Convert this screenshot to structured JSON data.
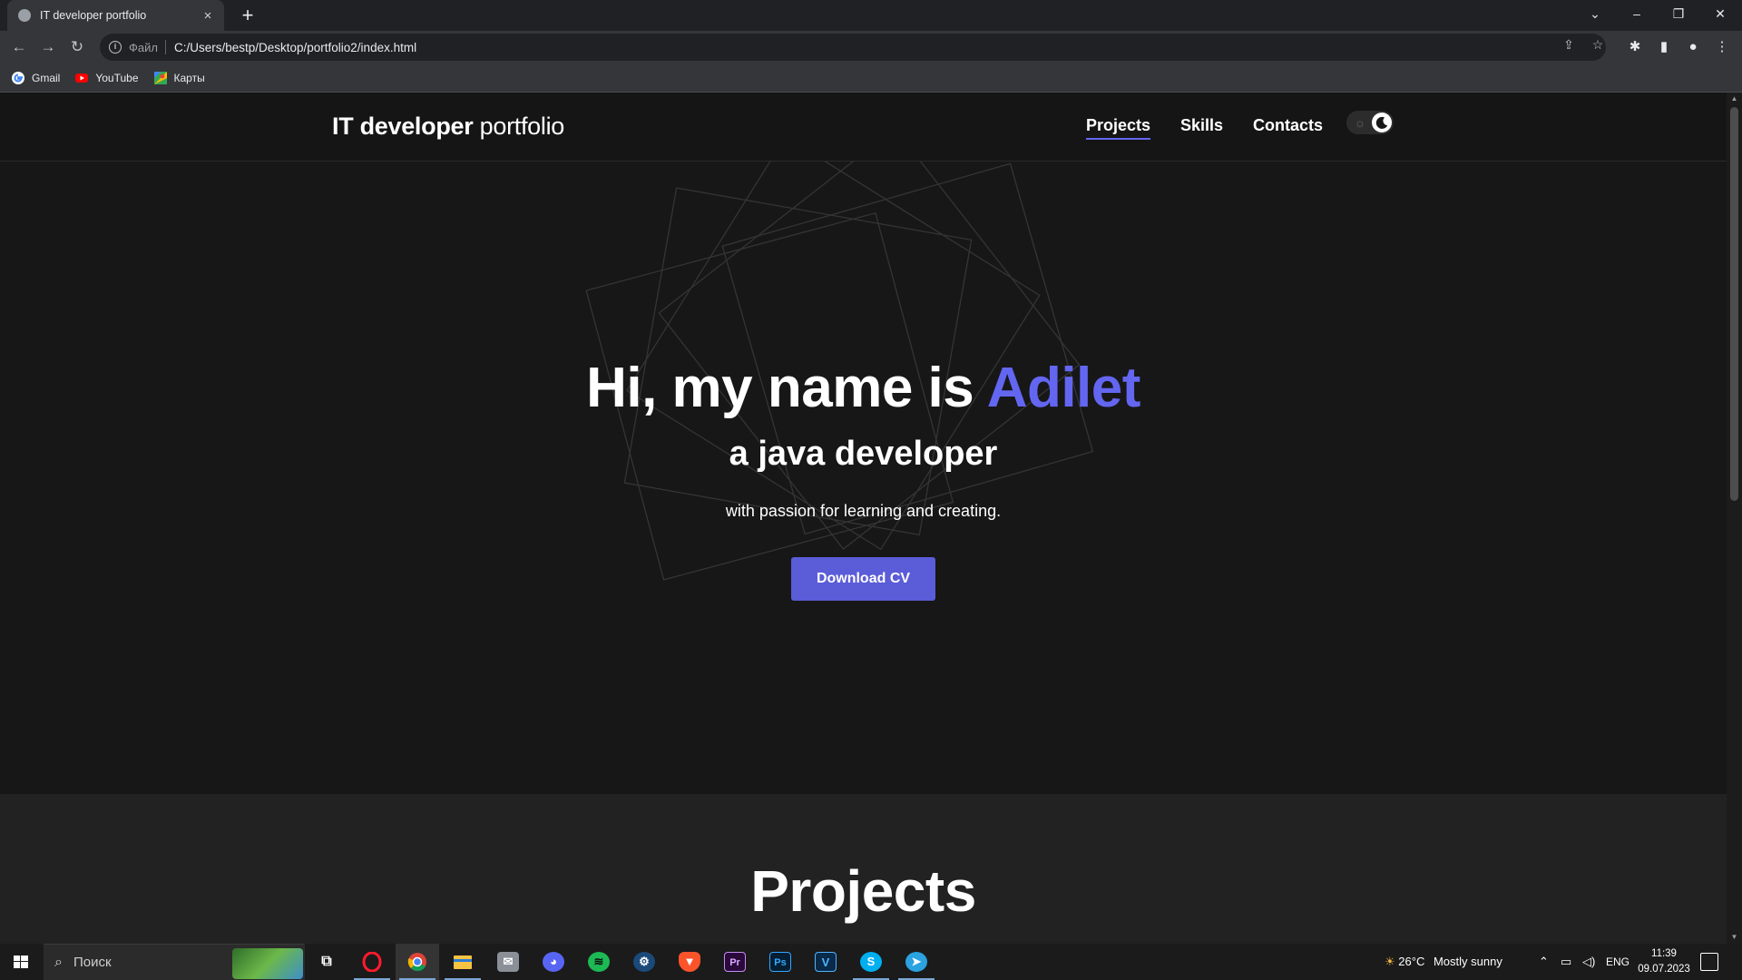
{
  "browser": {
    "tab_title": "IT developer portfolio",
    "tab_close": "×",
    "new_tab": "+",
    "scheme_label": "Файл",
    "url": "C:/Users/bestp/Desktop/portfolio2/index.html",
    "bookmarks": [
      {
        "label": "Gmail",
        "icon": "gmail-icon"
      },
      {
        "label": "YouTube",
        "icon": "youtube-icon"
      },
      {
        "label": "Карты",
        "icon": "maps-icon"
      }
    ]
  },
  "site": {
    "logo_bold": "IT developer",
    "logo_light": "portfolio",
    "nav": [
      {
        "label": "Projects",
        "active": true
      },
      {
        "label": "Skills",
        "active": false
      },
      {
        "label": "Contacts",
        "active": false
      }
    ],
    "theme": "dark"
  },
  "hero": {
    "title_prefix": "Hi, my name is ",
    "title_name": "Adilet",
    "subtitle": "a java developer",
    "tagline": "with passion for learning and creating.",
    "cta_label": "Download CV"
  },
  "projects": {
    "heading": "Projects"
  },
  "taskbar": {
    "search_placeholder": "Поиск",
    "apps": [
      "task-view",
      "opera",
      "chrome",
      "file-explorer",
      "mail",
      "discord",
      "spotify",
      "steam",
      "brave",
      "premiere-pro",
      "photoshop",
      "vegas",
      "skype",
      "telegram"
    ],
    "weather_temp": "26°C",
    "weather_text": "Mostly sunny",
    "language": "ENG",
    "time": "11:39",
    "date": "09.07.2023"
  },
  "colors": {
    "accent": "#6366f1",
    "button": "#5b5cd8",
    "page_bg": "#171717"
  }
}
